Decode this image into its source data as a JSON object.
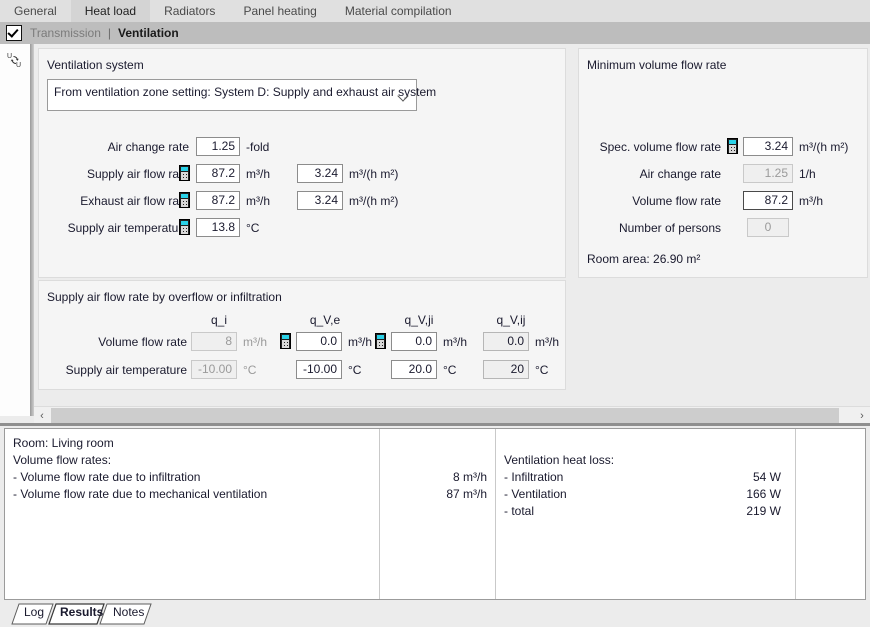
{
  "top_tabs": [
    {
      "label": "General",
      "active": false
    },
    {
      "label": "Heat load",
      "active": true
    },
    {
      "label": "Radiators",
      "active": false
    },
    {
      "label": "Panel heating",
      "active": false
    },
    {
      "label": "Material compilation",
      "active": false
    }
  ],
  "subbar": {
    "checkbox_checked": true,
    "items": [
      {
        "label": "Transmission",
        "active": false
      },
      {
        "label": "Ventilation",
        "active": true
      }
    ],
    "separator": "|"
  },
  "left_rail": {
    "icon_name": "unit-swap-icon",
    "icon_text_top": "U",
    "icon_text_bottom": "U"
  },
  "ventilation_system": {
    "title": "Ventilation system",
    "combo_value": "From ventilation zone setting: System D: Supply and exhaust air system",
    "rows": [
      {
        "label": "Air change rate",
        "has_calc": false,
        "value": "1.25",
        "unit": "-fold",
        "state": "normal",
        "value2": null,
        "unit2": null
      },
      {
        "label": "Supply air flow rate",
        "has_calc": true,
        "value": "87.2",
        "unit": "m³/h",
        "state": "normal",
        "value2": "3.24",
        "unit2": "m³/(h m²)"
      },
      {
        "label": "Exhaust air flow rate",
        "has_calc": true,
        "value": "87.2",
        "unit": "m³/h",
        "state": "normal",
        "value2": "3.24",
        "unit2": "m³/(h m²)"
      },
      {
        "label": "Supply air temperature",
        "has_calc": true,
        "value": "13.8",
        "unit": "°C",
        "state": "normal",
        "value2": null,
        "unit2": null
      }
    ]
  },
  "minimum_volume_flow": {
    "title": "Minimum volume flow rate",
    "rows": [
      {
        "label": "Spec. volume flow rate",
        "has_calc": true,
        "value": "3.24",
        "unit": "m³/(h m²)",
        "state": "normal"
      },
      {
        "label": "Air change rate",
        "has_calc": false,
        "value": "1.25",
        "unit": "1/h",
        "state": "disabled"
      },
      {
        "label": "Volume flow rate",
        "has_calc": false,
        "value": "87.2",
        "unit": "m³/h",
        "state": "focused"
      },
      {
        "label": "Number of persons",
        "has_calc": false,
        "value": "0",
        "unit": "",
        "state": "disabled"
      }
    ],
    "room_area": "Room area: 26.90 m²"
  },
  "overflow_panel": {
    "title": "Supply air flow rate by overflow or infiltration",
    "column_headers": [
      "q_i",
      "q_V,e",
      "q_V,ji",
      "q_V,ij"
    ],
    "row_labels": [
      "Volume flow rate",
      "Supply air temperature"
    ],
    "columns": [
      {
        "header": "q_i",
        "has_calc": false,
        "flow_value": "8",
        "flow_unit": "m³/h",
        "flow_state": "disabled",
        "temp_value": "-10.00",
        "temp_unit": "°C",
        "temp_state": "disabled"
      },
      {
        "header": "q_V,e",
        "has_calc": true,
        "flow_value": "0.0",
        "flow_unit": "m³/h",
        "flow_state": "normal",
        "temp_value": "-10.00",
        "temp_unit": "°C",
        "temp_state": "normal"
      },
      {
        "header": "q_V,ji",
        "has_calc": true,
        "flow_value": "0.0",
        "flow_unit": "m³/h",
        "flow_state": "normal",
        "temp_value": "20.0",
        "temp_unit": "°C",
        "temp_state": "normal"
      },
      {
        "header": "q_V,ij",
        "has_calc": false,
        "flow_value": "0.0",
        "flow_unit": "m³/h",
        "flow_state": "readonly",
        "temp_value": "20",
        "temp_unit": "°C",
        "temp_state": "readonly"
      }
    ]
  },
  "scrollbar": {
    "left_arrow": "‹",
    "right_arrow": "›"
  },
  "results": {
    "left": {
      "lines": [
        "Room: Living room",
        "Volume flow rates:",
        "- Volume flow rate due to infiltration",
        "- Volume flow rate due to mechanical ventilation"
      ]
    },
    "left_values": [
      "8 m³/h",
      "87 m³/h"
    ],
    "right": {
      "lines": [
        "Ventilation heat loss:",
        "- Infiltration",
        "- Ventilation",
        "- total"
      ]
    },
    "right_values": [
      "54 W",
      "166 W",
      "219 W"
    ]
  },
  "bottom_tabs": [
    {
      "label": "Log",
      "selected": false
    },
    {
      "label": "Results",
      "selected": true
    },
    {
      "label": "Notes",
      "selected": false
    }
  ]
}
